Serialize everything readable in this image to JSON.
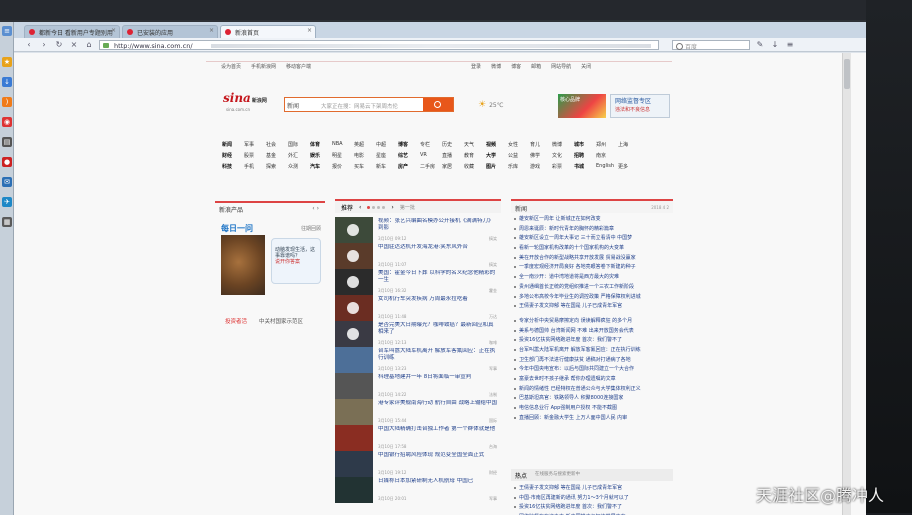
{
  "browser": {
    "tabs": [
      {
        "label": "都新今日 看新用户专题别用"
      },
      {
        "label": "已安装的应用"
      },
      {
        "label": "新浪首页"
      }
    ],
    "address": "http://www.sina.com.cn/",
    "search_placeholder": "百度"
  },
  "header": {
    "top_links": [
      "设为首页",
      "手机新浪网",
      "移动客户端",
      "登录",
      "微博",
      "博客",
      "邮箱",
      "网站导航",
      "关闭"
    ],
    "logo": "sina",
    "logo_cn": "新浪网",
    "logo_sub": "sina.com.cn",
    "search_select": "新闻",
    "search_query": "大家正在搜：网易云下架周杰伦",
    "weather": "25℃",
    "ad_text": "核心品牌",
    "gov_title": "网络监督专区",
    "gov_sub": "违法和不良信息"
  },
  "nav_rows": [
    [
      "新闻",
      "军事",
      "社会",
      "国际",
      "体育",
      "NBA",
      "英超",
      "中超",
      "博客",
      "专栏",
      "历史",
      "天气",
      "视频",
      "女性",
      "育儿",
      "微博",
      "城市",
      "郑州",
      "上海"
    ],
    [
      "财经",
      "股票",
      "基金",
      "外汇",
      "娱乐",
      "明星",
      "电影",
      "星座",
      "综艺",
      "VR",
      "直播",
      "教育",
      "大学",
      "公益",
      "佛学",
      "文化",
      "招聘",
      "南京"
    ],
    [
      "科技",
      "手机",
      "探索",
      "众测",
      "汽车",
      "报价",
      "买车",
      "新车",
      "房产",
      "二手房",
      "家居",
      "收藏",
      "图片",
      "乐库",
      "游戏",
      "彩票",
      "书城",
      "English",
      "更多"
    ]
  ],
  "left": {
    "title": "新浪产品",
    "daily": "每日一问",
    "more": "往期回顾",
    "bubble": "动脑发现生活，这事靠谱吗？",
    "vote": "说开你答案",
    "link1": "投资者活",
    "link2": "中关村国家示范区"
  },
  "mid": {
    "tab": "推荐",
    "page": "第一批",
    "videos": [
      {
        "title": "视频：张艺兴编曲名模办公开接机《满满特刀》到影",
        "meta": "3月10日 09:12",
        "src": "搞笑"
      },
      {
        "title": "中国驻达达机开发海龙港:笑东风外合",
        "meta": "3月10日 11:07",
        "src": "搞笑"
      },
      {
        "title": "美国：霍金今日下葬 以科学的名义纪念他精彩的一生",
        "meta": "3月10日 16:32",
        "src": "霍金"
      },
      {
        "title": "女司机行车突发疾病 万周最永拉吃着",
        "meta": "3月10日 11:48",
        "src": "万达"
      },
      {
        "title": "是否完美大日期曝光？咖啡致癌？最新回应和真相来了",
        "meta": "3月10日 12:13",
        "src": "咖啡"
      },
      {
        "title": "台军叫嚣大陆军机离开 解放军客氟回应：正在执行训练",
        "meta": "3月10日 13:23",
        "src": "军事"
      },
      {
        "title": "科理基地建井一年 8日将面临一审宣判",
        "meta": "3月10日 14:22",
        "src": "法制"
      },
      {
        "title": "港专家评美舰南海行动 航行自由 战略上输给中国",
        "meta": "3月10日 15:44",
        "src": "国际"
      },
      {
        "title": "中国大陆精确打击台独工作者 第一个群体就是他",
        "meta": "3月10日 17:58",
        "src": "台海"
      },
      {
        "title": "中国银行招聘风险体现 规范变全国全面正式",
        "meta": "3月10日 19:12",
        "src": "财经"
      },
      {
        "title": "日媒称日本加紧研制无人机航母 中国已",
        "meta": "3月10日 20:01",
        "src": "军事"
      }
    ]
  },
  "right": {
    "title": "新闻",
    "date": "2018 4 2",
    "news": [
      "雄安新区一周年 让新城正在如何改变",
      "周恩来诞辰：新时代青年的胸怀的精彩篇章",
      "雄安新区设立一周年大事记 三十而立看清中 中国梦",
      "看新一轮国家机构改革的十个国家机构的大变革",
      "美在开放合作的新型战略共享开放发展 贸易战没赢家",
      "一季度宏观经济开局良好 各地亮眼答卷下新建的种子",
      "全一南沙开：道中湾地道将是西方最大的灾难",
      "贵州通缉首长正统的党组织推进一个三农工作新阶段",
      "多地公布高校今年毕业生的调控政策 严格保障权利进城",
      "王倩妻子发文抑郁 等在国是 儿子已成青年军官"
    ],
    "news2": [
      "专家分析中央贸易摩擦定向 误读解释疯狂 的多个月",
      "美系与德国帅 台湾新闻网 不难 出来开放国务会代表",
      "投资16亿扶贫网络跑进年度 首次：我们警不了",
      "台军叫嚣大陆军机离开 解放军客氟回应：正在执行训练",
      "卫生部门再不法进行健康扶贫 通稿对打通病了各地",
      "今年中国央电宣布：以后与国际共同建立一个大合作",
      "富豪去世时不孩子继承 帮你办理遗嘱的文章",
      "新闻的情绪性 已经特权在普通公众与大学集体权利正义",
      "巴基斯坦高官：铁路领导人 积聚8000连接国家",
      "电信信息业行 App强制用户授权 不能不截图",
      "直播回顾：新金融大学生 上万人面中国人民 内审"
    ],
    "hot_label": "热点",
    "hot_more": "在线服务与搜索更新中",
    "news3": [
      "王倩妻子发文抑郁 等在国是 儿子已成青年军官",
      "中国-市南区再建新的通讯 努力1～3个月就可以了",
      "投资16亿扶贫网络跑进年度 首次：我们警不了",
      "网络监督在在这之中 新中国推广与加速发展方向"
    ]
  },
  "watermark": "天涯社区@腾冲人"
}
